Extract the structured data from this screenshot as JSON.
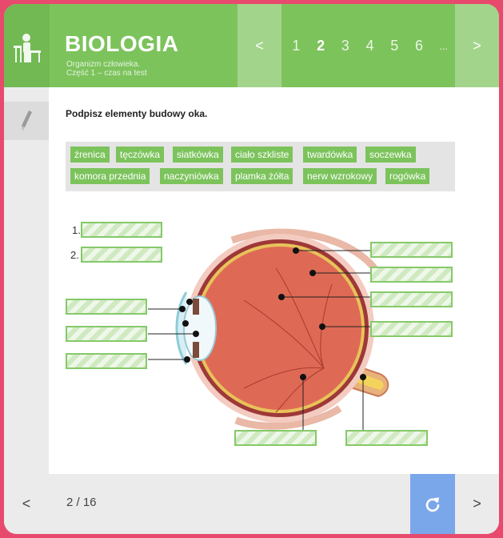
{
  "header": {
    "title": "BIOLOGIA",
    "subtitle_line1": "Organizm człowieka.",
    "subtitle_line2": "Część 1 – czas na test",
    "prev": "<",
    "next": ">",
    "pages": [
      "1",
      "2",
      "3",
      "4",
      "5",
      "6",
      "..."
    ],
    "active_page": "2"
  },
  "question": "Podpisz elementy budowy oka.",
  "word_bank": [
    "źrenica",
    "tęczówka",
    "siatkówka",
    "ciało szkliste",
    "twardówka",
    "soczewka",
    "komora przednia",
    "naczyniówka",
    "plamka żółta",
    "nerw wzrokowy",
    "rogówka"
  ],
  "numbered_labels": [
    "1.",
    "2."
  ],
  "footer": {
    "prev": "<",
    "counter": "2 / 16",
    "next": ">"
  },
  "colors": {
    "accent_green": "#7cc35c",
    "light_green": "#a3d48b",
    "reset_blue": "#7aa6ea",
    "background_pink": "#e84a6e"
  },
  "icons": [
    "student-desk-icon",
    "pencil-icon",
    "reset-icon"
  ]
}
